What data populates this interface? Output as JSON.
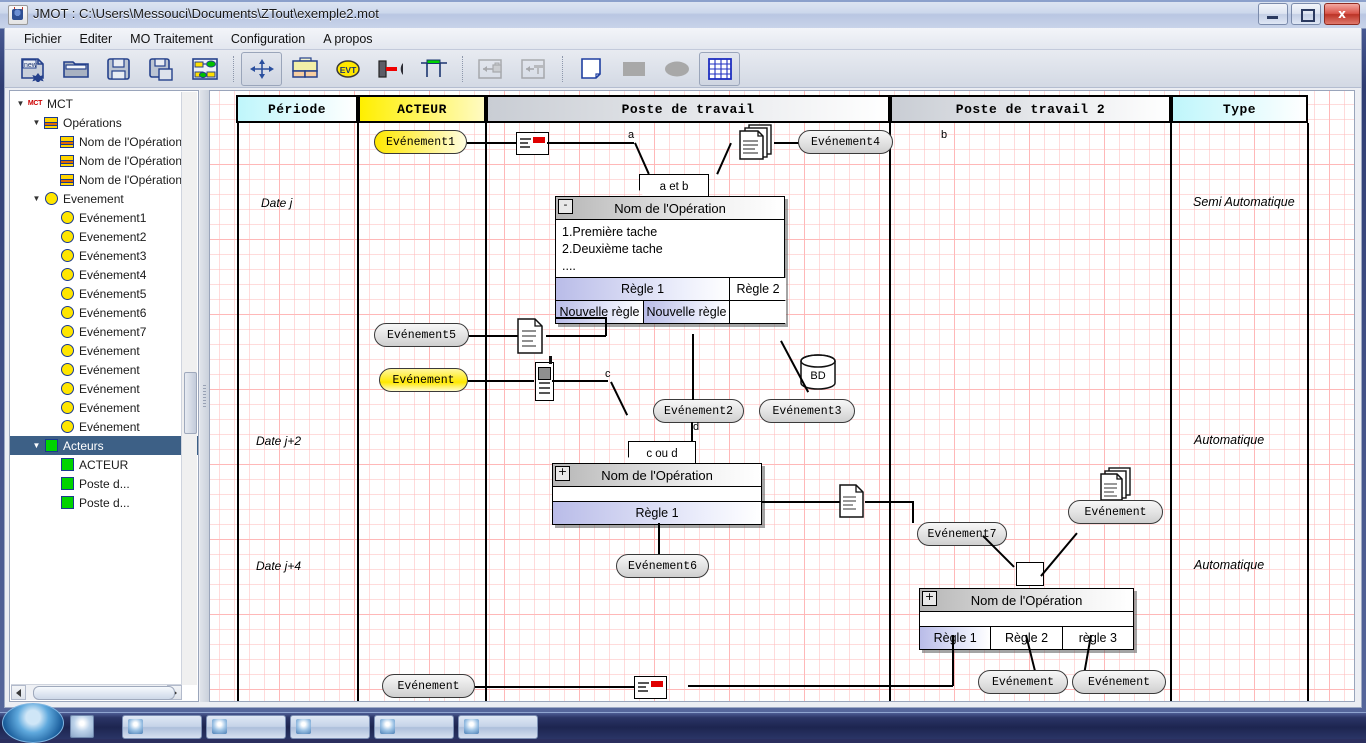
{
  "window": {
    "title": "JMOT : C:\\Users\\Messouci\\Documents\\ZTout\\exemple2.mot",
    "app_icon": "java-cup-icon",
    "minimize_label": "",
    "maximize_label": "",
    "close_label": "x"
  },
  "menu": {
    "items": [
      {
        "label": "Fichier"
      },
      {
        "label": "Editer"
      },
      {
        "label": "MO Traitement"
      },
      {
        "label": "Configuration"
      },
      {
        "label": "A propos"
      }
    ]
  },
  "toolbar": {
    "buttons": [
      {
        "name": "new-file-button",
        "icon": "new-document-icon",
        "selected": false
      },
      {
        "name": "open-file-button",
        "icon": "open-folder-icon",
        "selected": false
      },
      {
        "name": "save-button",
        "icon": "floppy-save-icon",
        "selected": false
      },
      {
        "name": "save-as-button",
        "icon": "floppy-save-as-icon",
        "selected": false
      },
      {
        "name": "model-tree-button",
        "icon": "model-graph-icon",
        "selected": false
      },
      {
        "name": "move-tool-button",
        "icon": "four-arrows-move-icon",
        "selected": true
      },
      {
        "name": "operation-tool-button",
        "icon": "operation-box-icon",
        "selected": false
      },
      {
        "name": "event-tool-button",
        "icon": "evt-oval-icon",
        "selected": false
      },
      {
        "name": "link-tool-button",
        "icon": "link-arrow-icon",
        "selected": false
      },
      {
        "name": "synchro-tool-button",
        "icon": "synchro-bar-icon",
        "selected": false
      },
      {
        "name": "import-actor-button",
        "icon": "import-briefcase-icon",
        "selected": false,
        "disabled": true
      },
      {
        "name": "import-poste-button",
        "icon": "import-poste-icon",
        "selected": false,
        "disabled": true
      },
      {
        "name": "shape-rect-white-button",
        "icon": "white-page-icon",
        "selected": false
      },
      {
        "name": "shape-rect-grey-button",
        "icon": "grey-rectangle-icon",
        "selected": false
      },
      {
        "name": "shape-ellipse-button",
        "icon": "grey-ellipse-icon",
        "selected": false
      },
      {
        "name": "grid-toggle-button",
        "icon": "grid-table-icon",
        "selected": true
      }
    ]
  },
  "tree": {
    "nodes": [
      {
        "label": "MCT",
        "icon": "mct-icon",
        "depth": 0,
        "twisty": "▼",
        "selected": false
      },
      {
        "label": "Opérations",
        "icon": "operation-icon",
        "depth": 1,
        "twisty": "▼",
        "selected": false
      },
      {
        "label": "Nom de l'Opération",
        "icon": "operation-icon",
        "depth": 2,
        "twisty": "",
        "selected": false
      },
      {
        "label": "Nom de l'Opération",
        "icon": "operation-icon",
        "depth": 2,
        "twisty": "",
        "selected": false
      },
      {
        "label": "Nom de l'Opération",
        "icon": "operation-icon",
        "depth": 2,
        "twisty": "",
        "selected": false
      },
      {
        "label": "Evenement",
        "icon": "event-icon",
        "depth": 1,
        "twisty": "▼",
        "selected": false
      },
      {
        "label": "Evénement1",
        "icon": "event-icon",
        "depth": 2,
        "twisty": "",
        "selected": false
      },
      {
        "label": "Evenement2",
        "icon": "event-icon",
        "depth": 2,
        "twisty": "",
        "selected": false
      },
      {
        "label": "Evénement3",
        "icon": "event-icon",
        "depth": 2,
        "twisty": "",
        "selected": false
      },
      {
        "label": "Evénement4",
        "icon": "event-icon",
        "depth": 2,
        "twisty": "",
        "selected": false
      },
      {
        "label": "Evénement5",
        "icon": "event-icon",
        "depth": 2,
        "twisty": "",
        "selected": false
      },
      {
        "label": "Evénement6",
        "icon": "event-icon",
        "depth": 2,
        "twisty": "",
        "selected": false
      },
      {
        "label": "Evénement7",
        "icon": "event-icon",
        "depth": 2,
        "twisty": "",
        "selected": false
      },
      {
        "label": "Evénement",
        "icon": "event-icon",
        "depth": 2,
        "twisty": "",
        "selected": false
      },
      {
        "label": "Evénement",
        "icon": "event-icon",
        "depth": 2,
        "twisty": "",
        "selected": false
      },
      {
        "label": "Evénement",
        "icon": "event-icon",
        "depth": 2,
        "twisty": "",
        "selected": false
      },
      {
        "label": "Evénement",
        "icon": "event-icon",
        "depth": 2,
        "twisty": "",
        "selected": false
      },
      {
        "label": "Evénement",
        "icon": "event-icon",
        "depth": 2,
        "twisty": "",
        "selected": false
      },
      {
        "label": "Acteurs",
        "icon": "actor-icon",
        "depth": 1,
        "twisty": "▼",
        "selected": true
      },
      {
        "label": "ACTEUR",
        "icon": "actor-icon",
        "depth": 2,
        "twisty": "",
        "selected": false
      },
      {
        "label": "Poste d...",
        "icon": "actor-icon",
        "depth": 2,
        "twisty": "",
        "selected": false
      },
      {
        "label": "Poste d...",
        "icon": "actor-icon",
        "depth": 2,
        "twisty": "",
        "selected": false
      }
    ]
  },
  "diagram": {
    "columns": [
      {
        "label": "Période",
        "style": "cyan"
      },
      {
        "label": "ACTEUR",
        "style": "yellow"
      },
      {
        "label": "Poste de travail",
        "style": "grey"
      },
      {
        "label": "Poste de travail 2",
        "style": "grey"
      },
      {
        "label": "Type",
        "style": "cyan"
      }
    ],
    "periods": [
      {
        "label": "Date j"
      },
      {
        "label": "Date j+2"
      },
      {
        "label": "Date j+4"
      }
    ],
    "types": [
      {
        "label": "Semi Automatique"
      },
      {
        "label": "Automatique"
      },
      {
        "label": "Automatique"
      }
    ],
    "events": [
      {
        "id": "ev1",
        "label": "Evénement1",
        "style": "yellow"
      },
      {
        "id": "ev4",
        "label": "Evénement4",
        "style": "grey"
      },
      {
        "id": "ev5",
        "label": "Evénement5",
        "style": "grey"
      },
      {
        "id": "ev2",
        "label": "Evénement2",
        "style": "grey"
      },
      {
        "id": "ev3",
        "label": "Evénement3",
        "style": "grey"
      },
      {
        "id": "evA",
        "label": "Evénement",
        "style": "yellow"
      },
      {
        "id": "ev6",
        "label": "Evénement6",
        "style": "grey"
      },
      {
        "id": "ev7",
        "label": "Evénement7",
        "style": "grey"
      },
      {
        "id": "evB",
        "label": "Evénement",
        "style": "grey"
      },
      {
        "id": "evC",
        "label": "Evénement",
        "style": "grey"
      },
      {
        "id": "evD",
        "label": "Evénement",
        "style": "grey"
      },
      {
        "id": "evE",
        "label": "Evénement",
        "style": "grey"
      }
    ],
    "operations": [
      {
        "id": "op1",
        "title": "Nom de l'Opération",
        "expander": "-",
        "tasks": [
          "1.Première tache",
          "2.Deuxième tache",
          " ...."
        ],
        "rules_row1": [
          "Règle 1"
        ],
        "rules_row2": [
          "Nouvelle règle",
          "Nouvelle règle"
        ],
        "rules_side": [
          "Règle 2"
        ]
      },
      {
        "id": "op2",
        "title": "Nom de l'Opération",
        "expander": "+",
        "tasks": [],
        "rules_row1": [
          "Règle 1"
        ]
      },
      {
        "id": "op3",
        "title": "Nom de l'Opération",
        "expander": "+",
        "tasks": [],
        "rules_row1": [
          "Règle 1",
          "Règle 2",
          "règle 3"
        ]
      }
    ],
    "synchronizations": [
      {
        "id": "sync1",
        "label": "a et b",
        "inputs": [
          "a",
          "b"
        ]
      },
      {
        "id": "sync2",
        "label": "c ou d",
        "inputs": [
          "c",
          "d"
        ]
      },
      {
        "id": "sync3",
        "label": "",
        "inputs": []
      }
    ],
    "edge_labels": [
      "a",
      "b",
      "c",
      "d"
    ],
    "database_label": "BD",
    "media_icons": [
      {
        "name": "mail-icon"
      },
      {
        "name": "documents-stack-icon"
      },
      {
        "name": "document-icon"
      },
      {
        "name": "mobile-phone-icon"
      },
      {
        "name": "database-icon"
      },
      {
        "name": "document-icon"
      },
      {
        "name": "documents-stack-icon"
      },
      {
        "name": "mail-icon"
      }
    ]
  },
  "colors": {
    "accent_blue": "#3d6086",
    "event_yellow": "#ffe800",
    "rule_lavender": "#b9bce8",
    "header_cyan": "#bff6fb",
    "grid_pink": "#ffbebe"
  }
}
